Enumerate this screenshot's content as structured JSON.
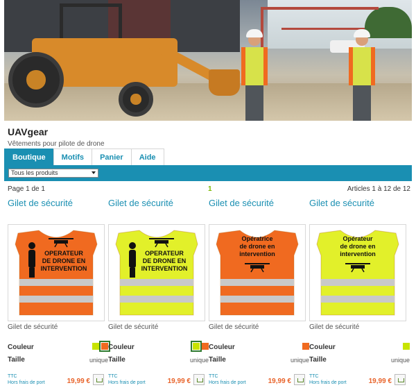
{
  "site": {
    "title": "UAVgear",
    "subtitle": "Vêtements pour pilote de drone"
  },
  "tabs": [
    {
      "label": "Boutique",
      "active": true
    },
    {
      "label": "Motifs",
      "active": false
    },
    {
      "label": "Panier",
      "active": false
    },
    {
      "label": "Aide",
      "active": false
    }
  ],
  "filter": {
    "selected": "Tous les produits"
  },
  "pagination": {
    "page_info": "Page 1 de 1",
    "current_page": "1",
    "articles": "Articles 1 à 12 de 12"
  },
  "labels": {
    "couleur": "Couleur",
    "taille": "Taille",
    "ttc": "TTC",
    "shipping": "Hors frais de port"
  },
  "products": [
    {
      "title": "Gilet de sécurité",
      "subtitle": "Gilet de sécurité",
      "taille": "unique",
      "price": "19,99 €",
      "vest_color": "#f06a20",
      "print_lines": [
        "OPERATEUR",
        "DE DRONE EN",
        "INTERVENTION"
      ],
      "swatches": [
        {
          "color": "#c8e400",
          "selected": false
        },
        {
          "color": "#f06a20",
          "selected": true
        }
      ]
    },
    {
      "title": "Gilet de sécurité",
      "subtitle": "Gilet de sécurité",
      "taille": "unique",
      "price": "19,99 €",
      "vest_color": "#e2f02a",
      "print_lines": [
        "OPERATEUR",
        "DE DRONE EN",
        "INTERVENTION"
      ],
      "swatches": [
        {
          "color": "#c8e400",
          "selected": true
        },
        {
          "color": "#f06a20",
          "selected": false
        }
      ]
    },
    {
      "title": "Gilet de sécurité",
      "subtitle": "Gilet de sécurité",
      "taille": "unique",
      "price": "19,99 €",
      "vest_color": "#f06a20",
      "print_lines": [
        "Opératrice",
        "de drone en",
        "intervention"
      ],
      "swatches": [
        {
          "color": "#f06a20",
          "selected": false
        }
      ]
    },
    {
      "title": "Gilet de sécurité",
      "subtitle": "Gilet de sécurité",
      "taille": "unique",
      "price": "19,99 €",
      "vest_color": "#e2f02a",
      "print_lines": [
        "Opérateur",
        "de drone en",
        "intervention"
      ],
      "swatches": [
        {
          "color": "#c8e400",
          "selected": false
        }
      ]
    }
  ],
  "colors": {
    "accent": "#1a8fb2",
    "price": "#e8632a",
    "page_green": "#7ab800"
  }
}
